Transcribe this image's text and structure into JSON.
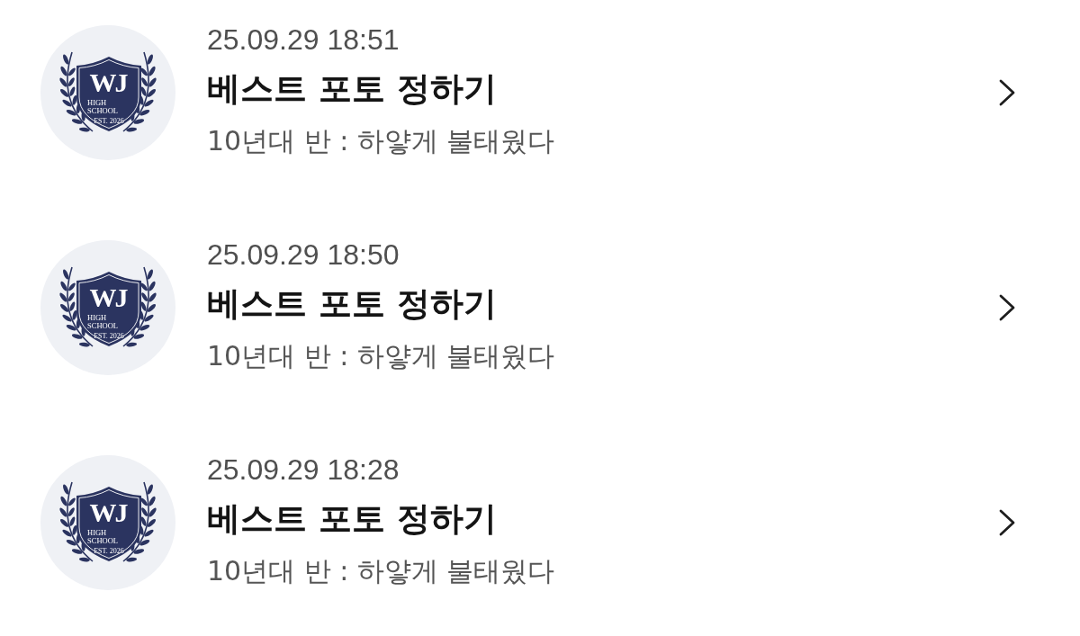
{
  "notifications": [
    {
      "logo": {
        "monogram": "WJ",
        "subtitle_lines": [
          "HIGH",
          "SCHOOL"
        ],
        "established": "EST. 2026"
      },
      "timestamp": "25.09.29 18:51",
      "title": "베스트 포토 정하기",
      "message": "10년대 반 : 하얗게 불태웠다"
    },
    {
      "logo": {
        "monogram": "WJ",
        "subtitle_lines": [
          "HIGH",
          "SCHOOL"
        ],
        "established": "EST. 2026"
      },
      "timestamp": "25.09.29 18:50",
      "title": "베스트 포토 정하기",
      "message": "10년대 반 : 하얗게 불태웠다"
    },
    {
      "logo": {
        "monogram": "WJ",
        "subtitle_lines": [
          "HIGH",
          "SCHOOL"
        ],
        "established": "EST. 2026"
      },
      "timestamp": "25.09.29 18:28",
      "title": "베스트 포토 정하기",
      "message": "10년대 반 : 하얗게 불태웠다"
    }
  ]
}
